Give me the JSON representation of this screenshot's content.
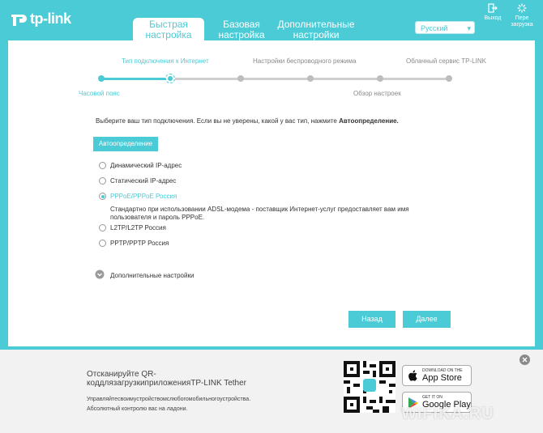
{
  "header": {
    "logo_text": "tp-link",
    "tabs": [
      {
        "label": "Быстрая\nнастройка"
      },
      {
        "label": "Базовая\nнастройка"
      },
      {
        "label": "Дополнительные\nнастройки"
      }
    ],
    "language": "Русский",
    "logout_label": "Выход",
    "reboot_label": "Пере\nзагрузка"
  },
  "wizard": {
    "steps_top": [
      "Тип подключения к Интернет",
      "Настройки беспроводного режима",
      "Облачный сервис TP-LINK"
    ],
    "steps_bottom": [
      "Часовой пояс",
      "Обзор настроек"
    ],
    "instruction": "Выберите ваш тип подключения. Если вы не уверены, какой у вас тип, нажмите ",
    "instruction_bold": "Автоопределение.",
    "autodetect_label": "Автоопределение",
    "options": [
      {
        "label": "Динамический IP-адрес",
        "selected": false
      },
      {
        "label": "Статический IP-адрес",
        "selected": false
      },
      {
        "label": "PPPoE/PPPoE Россия",
        "selected": true
      },
      {
        "label": "L2TP/L2TP Россия",
        "selected": false
      },
      {
        "label": "PPTP/PPTP Россия",
        "selected": false
      }
    ],
    "pppoe_desc_line1": "Стандартно при использовании ADSL-модема - поставщик Интернет-услуг предоставляет вам имя",
    "pppoe_desc_line2": "пользователя и пароль PPPoE.",
    "advanced_label": "Дополнительные настройки",
    "back_label": "Назад",
    "next_label": "Далее"
  },
  "footer": {
    "qr_line1": "Отсканируйте QR-",
    "qr_line2": "коддлязагрузкиприложенияTP-LINK Tether",
    "desc_line1": "Управляйтесвоимустройствомслюбогомобильногоустройства.",
    "desc_line2": "Абсолютный контролю вас на ладони.",
    "appstore_small": "DOWNLOAD ON THE",
    "appstore_big": "App Store",
    "gplay_small": "GET IT ON",
    "gplay_big": "Google Play",
    "watermark": "WIFIKA.RU"
  },
  "colors": {
    "accent": "#4acbd6",
    "progress_inactive": "#cfcfcf",
    "dot_inactive": "#bdbdbd"
  },
  "icons": [
    "logout-icon",
    "reboot-icon",
    "chevron-down-icon",
    "close-icon",
    "apple-icon",
    "google-play-icon",
    "qr-code-icon"
  ]
}
